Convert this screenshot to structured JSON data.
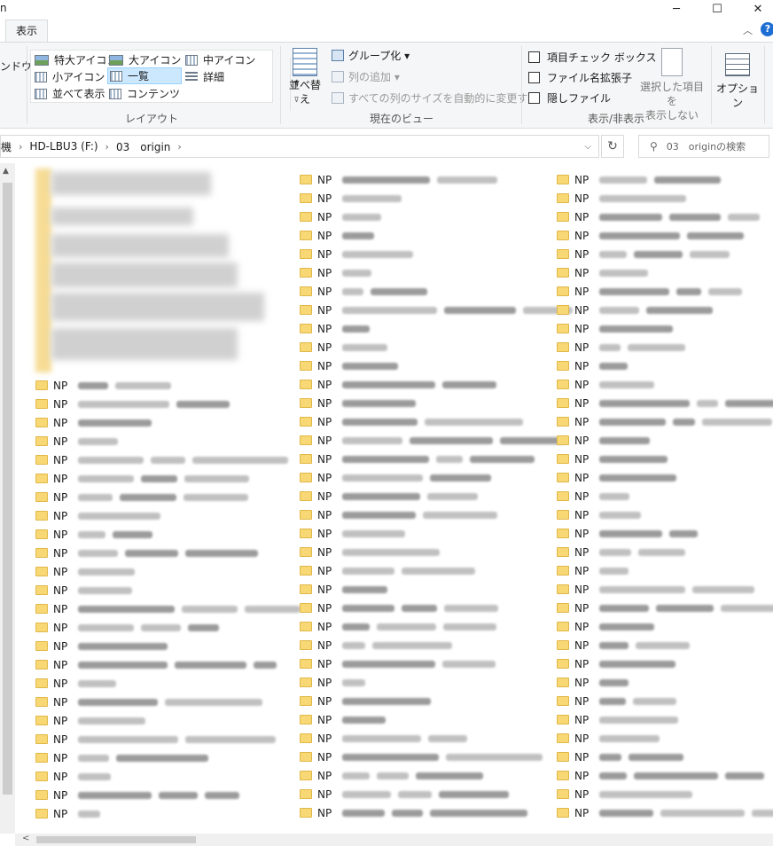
{
  "window": {
    "title_fragment": "n",
    "minimize": "─",
    "maximize": "☐",
    "close": "✕"
  },
  "ribbon_tabs": {
    "view": "表示",
    "collapse": "︿",
    "help": "?"
  },
  "ribbon": {
    "left_cut_label": "ンドウ",
    "layout": {
      "items": [
        "特大アイコン",
        "大アイコン",
        "中アイコン",
        "小アイコン",
        "一覧",
        "詳細",
        "並べて表示",
        "コンテンツ"
      ],
      "selected": "一覧",
      "group_label": "レイアウト"
    },
    "current_view": {
      "sort_by": "並べ替え",
      "group_by": "グループ化 ▾",
      "add_columns": "列の追加 ▾",
      "fit_columns": "すべての列のサイズを自動的に変更する",
      "group_label": "現在のビュー"
    },
    "show_hide": {
      "item_checkboxes": "項目チェック ボックス",
      "file_extensions": "ファイル名拡張子",
      "hidden_items": "隠しファイル",
      "hide_selected_line1": "選択した項目を",
      "hide_selected_line2": "表示しない",
      "group_label": "表示/非表示"
    },
    "options": "オプション"
  },
  "address_bar": {
    "segments": [
      "機",
      "HD-LBU3 (F:)",
      "03　origin"
    ],
    "search_placeholder": "03　originの検索"
  },
  "files": {
    "prefix": "NP",
    "col1_count": 24,
    "col2_count": 35,
    "col3_count": 35
  }
}
